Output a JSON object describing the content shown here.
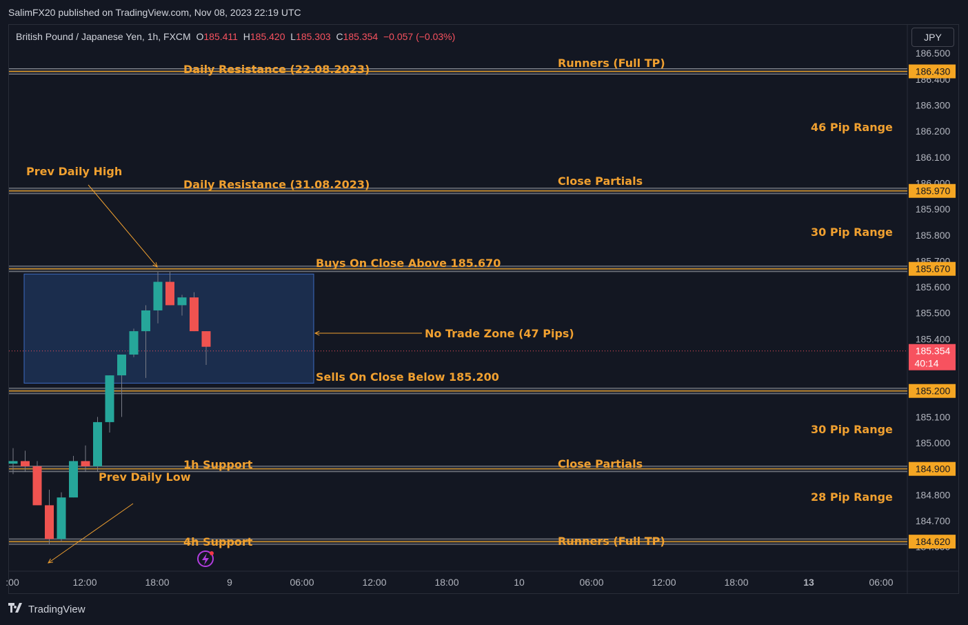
{
  "header": {
    "published_line": "SalimFX20 published on TradingView.com, Nov 08, 2023 22:19 UTC"
  },
  "legend": {
    "symbol": "British Pound / Japanese Yen, 1h, FXCM",
    "open_label": "O",
    "open": "185.411",
    "high_label": "H",
    "high": "185.420",
    "low_label": "L",
    "low": "185.303",
    "close_label": "C",
    "close": "185.354",
    "change": "−0.057 (−0.03%)"
  },
  "currency_button": "JPY",
  "footer": {
    "brand": "TradingView",
    "logo_icon": "tradingview-logo-icon"
  },
  "colors": {
    "background": "#131722",
    "bull": "#26a69a",
    "bear": "#ef5350",
    "level_line": "#f5a623",
    "annotation_text": "#f0a030",
    "zone_fill": "#1d3155",
    "zone_border": "#3d6cc4",
    "price_badge": "#f7525f"
  },
  "chart_data": {
    "type": "candlestick",
    "symbol": "British Pound / Japanese Yen",
    "timeframe": "1h",
    "ylim": [
      184.57,
      186.52
    ],
    "y_ticks": [
      "186.500",
      "186.400",
      "186.300",
      "186.200",
      "186.100",
      "186.000",
      "185.900",
      "185.800",
      "185.700",
      "185.600",
      "185.500",
      "185.400",
      "185.100",
      "185.000",
      "184.800",
      "184.700",
      "184.600"
    ],
    "x_ticks": [
      ":00",
      "12:00",
      "18:00",
      "9",
      "06:00",
      "12:00",
      "18:00",
      "10",
      "06:00",
      "12:00",
      "18:00",
      "13",
      "06:00"
    ],
    "bold_x_ticks": [
      "13"
    ],
    "candles": [
      {
        "o": 184.92,
        "h": 184.98,
        "l": 184.88,
        "c": 184.93
      },
      {
        "o": 184.93,
        "h": 184.97,
        "l": 184.89,
        "c": 184.91
      },
      {
        "o": 184.91,
        "h": 184.93,
        "l": 184.76,
        "c": 184.76
      },
      {
        "o": 184.76,
        "h": 184.82,
        "l": 184.61,
        "c": 184.63
      },
      {
        "o": 184.63,
        "h": 184.81,
        "l": 184.62,
        "c": 184.79
      },
      {
        "o": 184.79,
        "h": 184.95,
        "l": 184.79,
        "c": 184.93
      },
      {
        "o": 184.93,
        "h": 184.99,
        "l": 184.89,
        "c": 184.91
      },
      {
        "o": 184.91,
        "h": 185.1,
        "l": 184.89,
        "c": 185.08
      },
      {
        "o": 185.08,
        "h": 185.21,
        "l": 185.04,
        "c": 185.26
      },
      {
        "o": 185.26,
        "h": 185.34,
        "l": 185.1,
        "c": 185.34
      },
      {
        "o": 185.34,
        "h": 185.44,
        "l": 185.33,
        "c": 185.43
      },
      {
        "o": 185.43,
        "h": 185.53,
        "l": 185.25,
        "c": 185.51
      },
      {
        "o": 185.51,
        "h": 185.66,
        "l": 185.46,
        "c": 185.62
      },
      {
        "o": 185.62,
        "h": 185.66,
        "l": 185.55,
        "c": 185.53
      },
      {
        "o": 185.53,
        "h": 185.57,
        "l": 185.49,
        "c": 185.56
      },
      {
        "o": 185.56,
        "h": 185.58,
        "l": 185.44,
        "c": 185.43
      },
      {
        "o": 185.43,
        "h": 185.43,
        "l": 185.3,
        "c": 185.37
      }
    ],
    "current_price": {
      "value": "185.354",
      "countdown": "40:14"
    },
    "levels": [
      {
        "price": 186.43,
        "label": "186.430"
      },
      {
        "price": 185.97,
        "label": "185.970"
      },
      {
        "price": 185.67,
        "label": "185.670"
      },
      {
        "price": 185.2,
        "label": "185.200"
      },
      {
        "price": 184.9,
        "label": "184.900"
      },
      {
        "price": 184.62,
        "label": "184.620"
      }
    ],
    "zone": {
      "label": "No Trade Zone (47 Pips)",
      "top": 185.65,
      "bottom": 185.23
    },
    "annotations": [
      {
        "text": "Runners (Full TP)",
        "price": 186.45
      },
      {
        "text": "Daily Resistance (22.08.2023)",
        "price": 186.44
      },
      {
        "text": "46 Pip Range",
        "price": 186.19
      },
      {
        "text": "Prev Daily High",
        "price": 186.04
      },
      {
        "text": "Daily Resistance (31.08.2023)",
        "price": 185.99
      },
      {
        "text": "Close Partials",
        "price": 185.99
      },
      {
        "text": "30 Pip Range",
        "price": 185.82
      },
      {
        "text": "Buys On Close Above 185.670",
        "price": 185.7
      },
      {
        "text": "Sells On Close Below 185.200",
        "price": 185.1
      },
      {
        "text": "30 Pip Range",
        "price": 185.04
      },
      {
        "text": "1h Support",
        "price": 184.92
      },
      {
        "text": "Close Partials",
        "price": 184.92
      },
      {
        "text": "Prev Daily Low",
        "price": 184.77
      },
      {
        "text": "28 Pip Range",
        "price": 184.77
      },
      {
        "text": "4h Support",
        "price": 184.64
      },
      {
        "text": "Runners (Full TP)",
        "price": 184.64
      }
    ]
  }
}
